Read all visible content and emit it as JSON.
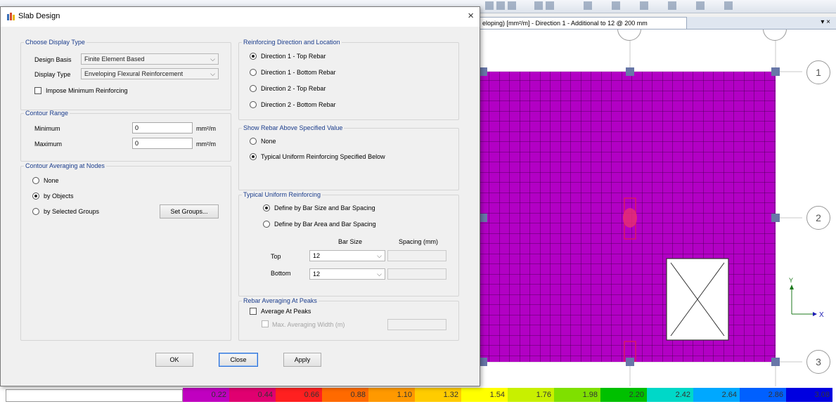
{
  "dialog": {
    "title": "Slab Design",
    "close_glyph": "×",
    "display_type": {
      "legend": "Choose Display Type",
      "design_basis_label": "Design Basis",
      "design_basis_value": "Finite Element Based",
      "display_type_label": "Display Type",
      "display_type_value": "Enveloping Flexural Reinforcement",
      "impose_min_label": "Impose Minimum Reinforcing"
    },
    "contour_range": {
      "legend": "Contour Range",
      "min_label": "Minimum",
      "min_value": "0",
      "max_label": "Maximum",
      "max_value": "0",
      "unit": "mm²/m"
    },
    "contour_averaging": {
      "legend": "Contour Averaging at Nodes",
      "opt_none": "None",
      "opt_objects": "by Objects",
      "opt_groups": "by Selected Groups",
      "set_groups_button": "Set Groups..."
    },
    "reinforcing_direction": {
      "legend": "Reinforcing Direction and Location",
      "opt1": "Direction 1 - Top Rebar",
      "opt2": "Direction 1 - Bottom Rebar",
      "opt3": "Direction 2 - Top Rebar",
      "opt4": "Direction 2 - Bottom Rebar"
    },
    "show_rebar": {
      "legend": "Show Rebar Above Specified Value",
      "opt_none": "None",
      "opt_typical": "Typical Uniform Reinforcing Specified Below"
    },
    "typical_uniform": {
      "legend": "Typical Uniform Reinforcing",
      "opt_size_spacing": "Define by Bar Size and Bar Spacing",
      "opt_area_spacing": "Define by Bar Area and Bar Spacing",
      "bar_size_header": "Bar Size",
      "spacing_header": "Spacing  (mm)",
      "top_label": "Top",
      "top_bar_size": "12",
      "bottom_label": "Bottom",
      "bottom_bar_size": "12"
    },
    "rebar_averaging": {
      "legend": "Rebar Averaging At Peaks",
      "average_label": "Average At Peaks",
      "max_width_label": "Max. Averaging Width  (m)"
    },
    "buttons": {
      "ok": "OK",
      "close": "Close",
      "apply": "Apply"
    }
  },
  "view": {
    "tab_title": "eloping) [mm²/m] - Direction 1 - Additional to 12 @ 200 mm",
    "menu_glyph": "▾ ×",
    "grid_labels": [
      "1",
      "2",
      "3"
    ],
    "axis_x": "X",
    "axis_y": "Y",
    "slab_color": "#b200c4",
    "legend_values": [
      "0.22",
      "0.44",
      "0.66",
      "0.88",
      "1.10",
      "1.32",
      "1.54",
      "1.76",
      "1.98",
      "2.20",
      "2.42",
      "2.64",
      "2.86",
      "3.08"
    ],
    "legend_colors": [
      "#c000c0",
      "#e00070",
      "#ff2020",
      "#ff6a00",
      "#ff9900",
      "#ffcc00",
      "#ffff00",
      "#c8f000",
      "#7fe000",
      "#00c000",
      "#00d8c8",
      "#00a8ff",
      "#0060ff",
      "#0000e0"
    ]
  }
}
